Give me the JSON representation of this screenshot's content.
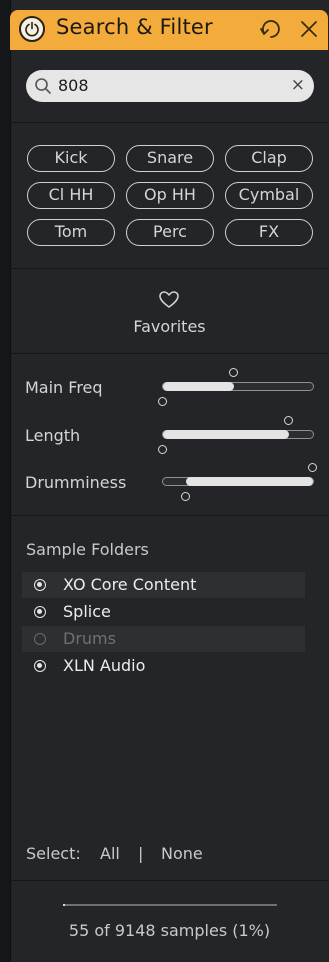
{
  "header": {
    "title": "Search & Filter",
    "accent_color": "#f3ab3b",
    "power_icon": "power-icon",
    "reset_icon": "reset-icon",
    "close_icon": "close-icon"
  },
  "search": {
    "value": "808",
    "icon": "search-icon",
    "clear_glyph": "×"
  },
  "tags": [
    {
      "label": "Kick"
    },
    {
      "label": "Snare"
    },
    {
      "label": "Clap"
    },
    {
      "label": "Cl HH"
    },
    {
      "label": "Op HH"
    },
    {
      "label": "Cymbal"
    },
    {
      "label": "Tom"
    },
    {
      "label": "Perc"
    },
    {
      "label": "FX"
    }
  ],
  "favorites": {
    "label": "Favorites",
    "icon": "heart-icon"
  },
  "sliders": [
    {
      "label": "Main Freq",
      "range_low": 0.0,
      "range_high": 0.47
    },
    {
      "label": "Length",
      "range_low": 0.0,
      "range_high": 0.84
    },
    {
      "label": "Drumminess",
      "range_low": 0.15,
      "range_high": 1.0
    }
  ],
  "sample_folders": {
    "title": "Sample Folders",
    "items": [
      {
        "label": "XO Core Content",
        "checked": true
      },
      {
        "label": "Splice",
        "checked": true
      },
      {
        "label": "Drums",
        "checked": false
      },
      {
        "label": "XLN Audio",
        "checked": true
      }
    ]
  },
  "select": {
    "label": "Select:",
    "all": "All",
    "separator": "|",
    "none": "None"
  },
  "footer": {
    "status": "55 of 9148 samples (1%)",
    "progress": 0.01
  }
}
